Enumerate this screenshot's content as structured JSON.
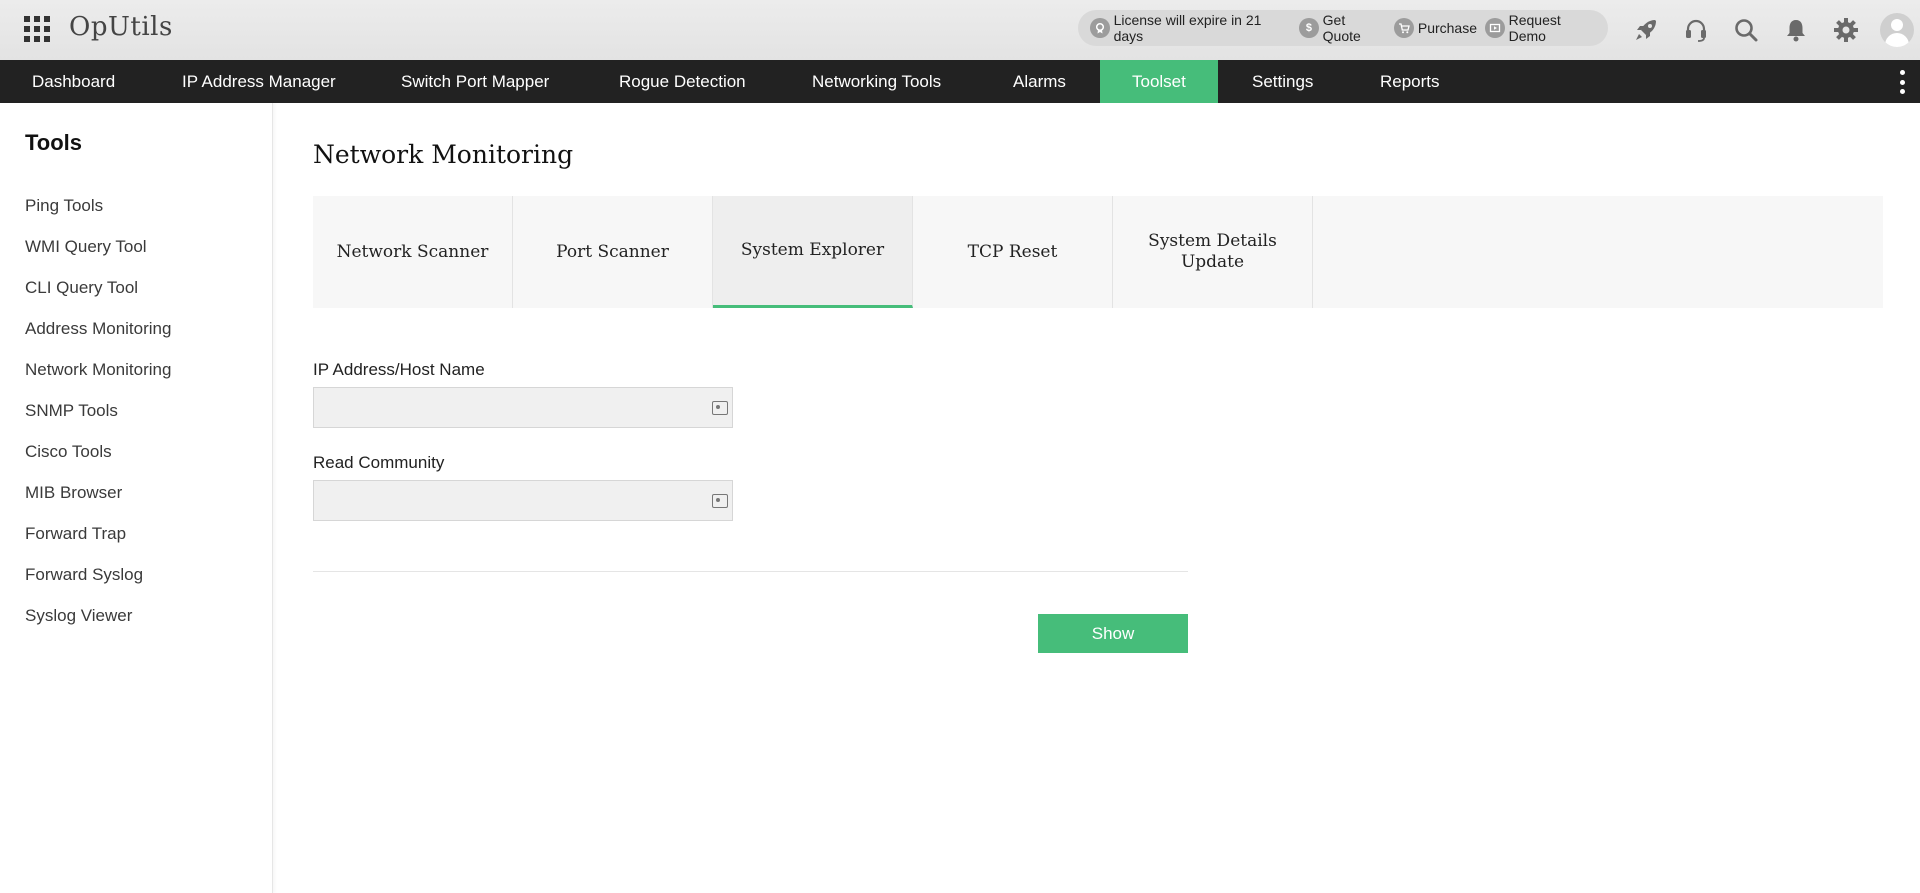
{
  "app": {
    "title": "OpUtils"
  },
  "topbar": {
    "license_text": "License will expire in 21 days",
    "get_quote": "Get Quote",
    "purchase": "Purchase",
    "request_demo": "Request Demo",
    "icons": [
      "rocket-icon",
      "support-headset-icon",
      "search-icon",
      "bell-icon",
      "gear-icon",
      "user-avatar-icon"
    ]
  },
  "nav": {
    "items": [
      {
        "label": "Dashboard"
      },
      {
        "label": "IP Address Manager"
      },
      {
        "label": "Switch Port Mapper"
      },
      {
        "label": "Rogue Detection"
      },
      {
        "label": "Networking Tools"
      },
      {
        "label": "Alarms"
      },
      {
        "label": "Toolset"
      },
      {
        "label": "Settings"
      },
      {
        "label": "Reports"
      }
    ],
    "active": "Toolset"
  },
  "sidebar": {
    "title": "Tools",
    "items": [
      {
        "label": "Ping Tools"
      },
      {
        "label": "WMI Query Tool"
      },
      {
        "label": "CLI Query Tool"
      },
      {
        "label": "Address Monitoring"
      },
      {
        "label": "Network Monitoring"
      },
      {
        "label": "SNMP Tools"
      },
      {
        "label": "Cisco Tools"
      },
      {
        "label": "MIB Browser"
      },
      {
        "label": "Forward Trap"
      },
      {
        "label": "Forward Syslog"
      },
      {
        "label": "Syslog Viewer"
      }
    ]
  },
  "main": {
    "title": "Network Monitoring",
    "tabs": [
      {
        "label": "Network Scanner"
      },
      {
        "label": "Port Scanner"
      },
      {
        "label": "System Explorer"
      },
      {
        "label": "TCP Reset"
      },
      {
        "label": "System Details Update"
      }
    ],
    "active_tab": "System Explorer",
    "form": {
      "ip_label": "IP Address/Host Name",
      "ip_value": "",
      "community_label": "Read Community",
      "community_value": "",
      "show_button": "Show"
    }
  },
  "colors": {
    "accent": "#46bd7a",
    "navbar": "#222222",
    "topbar": "#e6e6e6"
  }
}
